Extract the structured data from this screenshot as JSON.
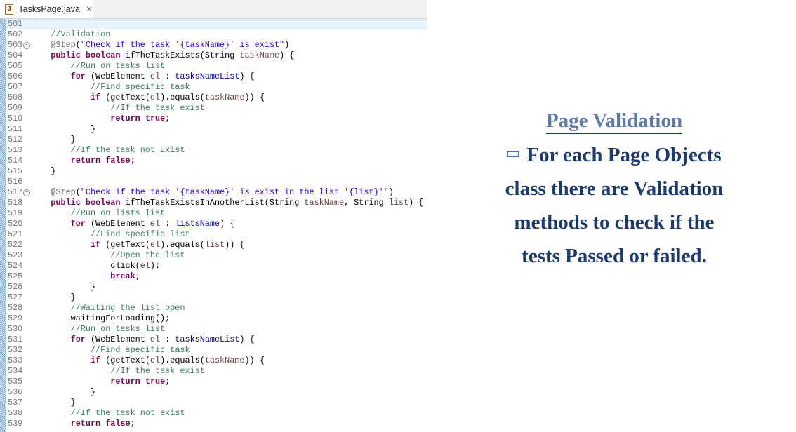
{
  "tab": {
    "title": "TasksPage.java",
    "icon": "java-file-icon",
    "close_icon": "close-icon"
  },
  "colors": {
    "keyword": "#7f0055",
    "string": "#2a00ff",
    "comment": "#3f7f5f",
    "annotation": "#646464",
    "field": "#0000c0",
    "local": "#6a3e3e",
    "slide_text": "#1b3a70"
  },
  "code": {
    "current_line": 501,
    "folds": [
      503,
      517
    ],
    "lines": [
      {
        "n": "501",
        "tokens": []
      },
      {
        "n": "502",
        "tokens": [
          [
            "t",
            "    "
          ],
          [
            "c",
            "//Validation"
          ]
        ]
      },
      {
        "n": "503",
        "tokens": [
          [
            "t",
            "    "
          ],
          [
            "a",
            "@Step"
          ],
          [
            "t",
            "("
          ],
          [
            "s",
            "\"Check if the task '{taskName}' is exist\""
          ],
          [
            "t",
            ")"
          ]
        ]
      },
      {
        "n": "504",
        "tokens": [
          [
            "t",
            "    "
          ],
          [
            "k",
            "public"
          ],
          [
            "t",
            " "
          ],
          [
            "k",
            "boolean"
          ],
          [
            "t",
            " ifTheTaskExists(String "
          ],
          [
            "v",
            "taskName"
          ],
          [
            "t",
            ") {"
          ]
        ]
      },
      {
        "n": "505",
        "tokens": [
          [
            "t",
            "        "
          ],
          [
            "c",
            "//Run on tasks list"
          ]
        ]
      },
      {
        "n": "506",
        "tokens": [
          [
            "t",
            "        "
          ],
          [
            "k",
            "for"
          ],
          [
            "t",
            " (WebElement "
          ],
          [
            "v",
            "el"
          ],
          [
            "t",
            " : "
          ],
          [
            "f",
            "tasksNameList"
          ],
          [
            "t",
            ") {"
          ]
        ]
      },
      {
        "n": "507",
        "tokens": [
          [
            "t",
            "            "
          ],
          [
            "c",
            "//Find specific task"
          ]
        ]
      },
      {
        "n": "508",
        "tokens": [
          [
            "t",
            "            "
          ],
          [
            "k",
            "if"
          ],
          [
            "t",
            " (getText("
          ],
          [
            "v",
            "el"
          ],
          [
            "t",
            ").equals("
          ],
          [
            "v",
            "taskName"
          ],
          [
            "t",
            ")) {"
          ]
        ]
      },
      {
        "n": "509",
        "tokens": [
          [
            "t",
            "                "
          ],
          [
            "c",
            "//If the task exist"
          ]
        ]
      },
      {
        "n": "510",
        "tokens": [
          [
            "t",
            "                "
          ],
          [
            "k",
            "return"
          ],
          [
            "t",
            " "
          ],
          [
            "k",
            "true"
          ],
          [
            "t",
            ";"
          ]
        ]
      },
      {
        "n": "511",
        "tokens": [
          [
            "t",
            "            }"
          ]
        ]
      },
      {
        "n": "512",
        "tokens": [
          [
            "t",
            "        }"
          ]
        ]
      },
      {
        "n": "513",
        "tokens": [
          [
            "t",
            "        "
          ],
          [
            "c",
            "//If the task not Exist"
          ]
        ]
      },
      {
        "n": "514",
        "tokens": [
          [
            "t",
            "        "
          ],
          [
            "k",
            "return"
          ],
          [
            "t",
            " "
          ],
          [
            "k",
            "false"
          ],
          [
            "t",
            ";"
          ]
        ]
      },
      {
        "n": "515",
        "tokens": [
          [
            "t",
            "    }"
          ]
        ]
      },
      {
        "n": "516",
        "tokens": []
      },
      {
        "n": "517",
        "tokens": [
          [
            "t",
            "    "
          ],
          [
            "a",
            "@Step"
          ],
          [
            "t",
            "("
          ],
          [
            "s",
            "\"Check if the task '{taskName}' is exist in the list '{list}'\""
          ],
          [
            "t",
            ")"
          ]
        ]
      },
      {
        "n": "518",
        "tokens": [
          [
            "t",
            "    "
          ],
          [
            "k",
            "public"
          ],
          [
            "t",
            " "
          ],
          [
            "k",
            "boolean"
          ],
          [
            "t",
            " ifTheTaskExistsInAnotherList(String "
          ],
          [
            "v",
            "taskName"
          ],
          [
            "t",
            ", String "
          ],
          [
            "v",
            "list"
          ],
          [
            "t",
            ") {"
          ]
        ]
      },
      {
        "n": "519",
        "tokens": [
          [
            "t",
            "        "
          ],
          [
            "c",
            "//Run on lists list"
          ]
        ]
      },
      {
        "n": "520",
        "tokens": [
          [
            "t",
            "        "
          ],
          [
            "k",
            "for"
          ],
          [
            "t",
            " (WebElement "
          ],
          [
            "v",
            "el"
          ],
          [
            "t",
            " : "
          ],
          [
            "f",
            "listsName"
          ],
          [
            "t",
            ") {"
          ]
        ]
      },
      {
        "n": "521",
        "tokens": [
          [
            "t",
            "            "
          ],
          [
            "c",
            "//Find specific list"
          ]
        ]
      },
      {
        "n": "522",
        "tokens": [
          [
            "t",
            "            "
          ],
          [
            "k",
            "if"
          ],
          [
            "t",
            " (getText("
          ],
          [
            "v",
            "el"
          ],
          [
            "t",
            ").equals("
          ],
          [
            "v",
            "list"
          ],
          [
            "t",
            ")) {"
          ]
        ]
      },
      {
        "n": "523",
        "tokens": [
          [
            "t",
            "                "
          ],
          [
            "c",
            "//Open the list"
          ]
        ]
      },
      {
        "n": "524",
        "tokens": [
          [
            "t",
            "                click("
          ],
          [
            "v",
            "el"
          ],
          [
            "t",
            ");"
          ]
        ]
      },
      {
        "n": "525",
        "tokens": [
          [
            "t",
            "                "
          ],
          [
            "k",
            "break"
          ],
          [
            "t",
            ";"
          ]
        ]
      },
      {
        "n": "526",
        "tokens": [
          [
            "t",
            "            }"
          ]
        ]
      },
      {
        "n": "527",
        "tokens": [
          [
            "t",
            "        }"
          ]
        ]
      },
      {
        "n": "528",
        "tokens": [
          [
            "t",
            "        "
          ],
          [
            "c",
            "//Waiting the list open"
          ]
        ]
      },
      {
        "n": "529",
        "tokens": [
          [
            "t",
            "        waitingForLoading();"
          ]
        ]
      },
      {
        "n": "530",
        "tokens": [
          [
            "t",
            "        "
          ],
          [
            "c",
            "//Run on tasks list"
          ]
        ]
      },
      {
        "n": "531",
        "tokens": [
          [
            "t",
            "        "
          ],
          [
            "k",
            "for"
          ],
          [
            "t",
            " (WebElement "
          ],
          [
            "v",
            "el"
          ],
          [
            "t",
            " : "
          ],
          [
            "f",
            "tasksNameList"
          ],
          [
            "t",
            ") {"
          ]
        ]
      },
      {
        "n": "532",
        "tokens": [
          [
            "t",
            "            "
          ],
          [
            "c",
            "//Find specific task"
          ]
        ]
      },
      {
        "n": "533",
        "tokens": [
          [
            "t",
            "            "
          ],
          [
            "k",
            "if"
          ],
          [
            "t",
            " (getText("
          ],
          [
            "v",
            "el"
          ],
          [
            "t",
            ").equals("
          ],
          [
            "v",
            "taskName"
          ],
          [
            "t",
            ")) {"
          ]
        ]
      },
      {
        "n": "534",
        "tokens": [
          [
            "t",
            "                "
          ],
          [
            "c",
            "//If the task exist"
          ]
        ]
      },
      {
        "n": "535",
        "tokens": [
          [
            "t",
            "                "
          ],
          [
            "k",
            "return"
          ],
          [
            "t",
            " "
          ],
          [
            "k",
            "true"
          ],
          [
            "t",
            ";"
          ]
        ]
      },
      {
        "n": "536",
        "tokens": [
          [
            "t",
            "            }"
          ]
        ]
      },
      {
        "n": "537",
        "tokens": [
          [
            "t",
            "        }"
          ]
        ]
      },
      {
        "n": "538",
        "tokens": [
          [
            "t",
            "        "
          ],
          [
            "c",
            "//If the task not exist"
          ]
        ]
      },
      {
        "n": "539",
        "tokens": [
          [
            "t",
            "        "
          ],
          [
            "k",
            "return"
          ],
          [
            "t",
            " "
          ],
          [
            "k",
            "false"
          ],
          [
            "t",
            ";"
          ]
        ]
      }
    ]
  },
  "slide": {
    "title": "Page Validation",
    "bullet_icon": "square-bullet-icon",
    "body_lines": [
      "For each Page Objects",
      "class there are Validation",
      "methods to check if the",
      "tests Passed or failed."
    ]
  }
}
